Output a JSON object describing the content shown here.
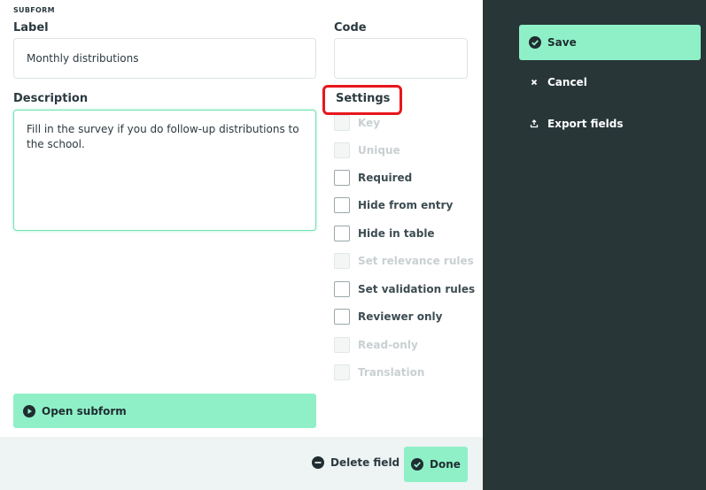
{
  "form": {
    "section_tag": "SUBFORM",
    "label_title": "Label",
    "label_value": "Monthly distributions",
    "code_title": "Code",
    "code_value": "",
    "description_title": "Description",
    "description_value": "Fill in the survey if you do follow-up distributions to the school."
  },
  "settings": {
    "title": "Settings",
    "items": [
      {
        "label": "Key",
        "enabled": false
      },
      {
        "label": "Unique",
        "enabled": false
      },
      {
        "label": "Required",
        "enabled": true
      },
      {
        "label": "Hide from entry",
        "enabled": true
      },
      {
        "label": "Hide in table",
        "enabled": true
      },
      {
        "label": "Set relevance rules",
        "enabled": false
      },
      {
        "label": "Set validation rules",
        "enabled": true
      },
      {
        "label": "Reviewer only",
        "enabled": true
      },
      {
        "label": "Read-only",
        "enabled": false
      },
      {
        "label": "Translation",
        "enabled": false
      }
    ]
  },
  "actions": {
    "open_subform": "Open subform",
    "delete_field": "Delete field",
    "done": "Done"
  },
  "sidebar": {
    "save": "Save",
    "cancel": "Cancel",
    "export_fields": "Export fields"
  },
  "icons": {
    "save": "check-circle-icon",
    "cancel": "x-icon",
    "export": "export-icon",
    "open_subform": "play-circle-icon",
    "delete": "minus-circle-icon",
    "done": "check-circle-icon"
  },
  "colors": {
    "accent": "#8ff0c8",
    "sidebar_bg": "#283638",
    "highlight": "#e8161c",
    "footer_bg": "#eef3f3"
  }
}
